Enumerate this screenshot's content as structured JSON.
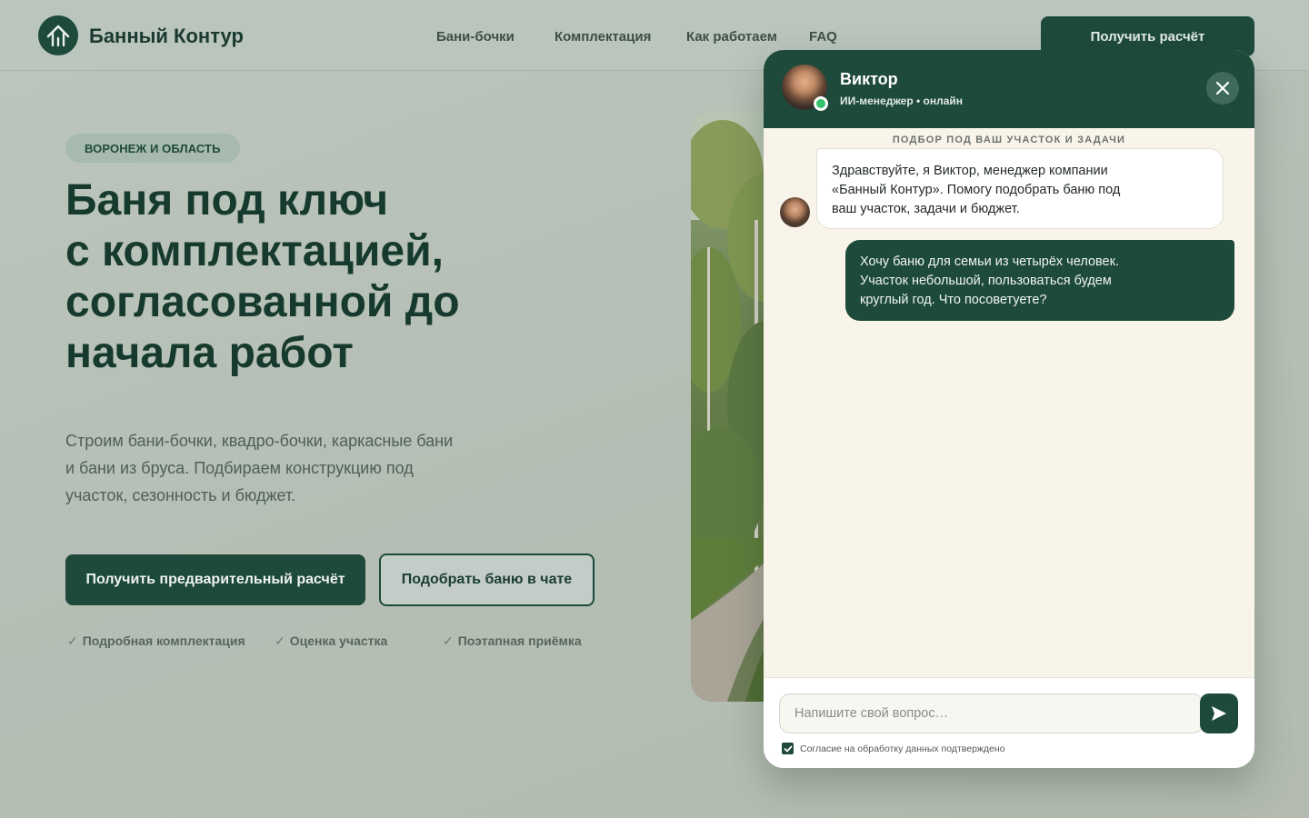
{
  "header": {
    "brand": "Банный Контур",
    "nav": [
      "Бани-бочки",
      "Комплектация",
      "Как работаем",
      "FAQ"
    ],
    "cta": "Получить расчёт"
  },
  "hero": {
    "badge": "ВОРОНЕЖ И ОБЛАСТЬ",
    "title_lines": [
      "Баня под ключ",
      "с комплектацией,",
      "согласованной до",
      "начала работ"
    ],
    "subtitle": "Строим бани-бочки, квадро-бочки, каркасные бани и бани из бруса. Подбираем конструкцию под участок, сезонность и бюджет.",
    "primary_button": "Получить предварительный расчёт",
    "secondary_button": "Подобрать баню в чате",
    "features": [
      "Подробная комплектация",
      "Оценка участка",
      "Поэтапная приёмка"
    ]
  },
  "chat": {
    "agent_name": "Виктор",
    "agent_status": "ИИ-менеджер • онлайн",
    "caption": "ПОДБОР ПОД ВАШ УЧАСТОК И ЗАДАЧИ",
    "messages": [
      {
        "from": "agent",
        "lines": [
          "Здравствуйте, я Виктор, менеджер компании",
          "«Банный Контур». Помогу подобрать баню под",
          "ваш участок, задачи и бюджет."
        ]
      },
      {
        "from": "user",
        "lines": [
          "Хочу баню для семьи из четырёх человек.",
          "Участок небольшой, пользоваться будем",
          "круглый год. Что посоветуете?"
        ]
      }
    ],
    "input_placeholder": "Напишите свой вопрос…",
    "consent": "Согласие на обработку данных подтверждено"
  },
  "colors": {
    "accent": "#1e4a3b",
    "online": "#36c26b"
  }
}
